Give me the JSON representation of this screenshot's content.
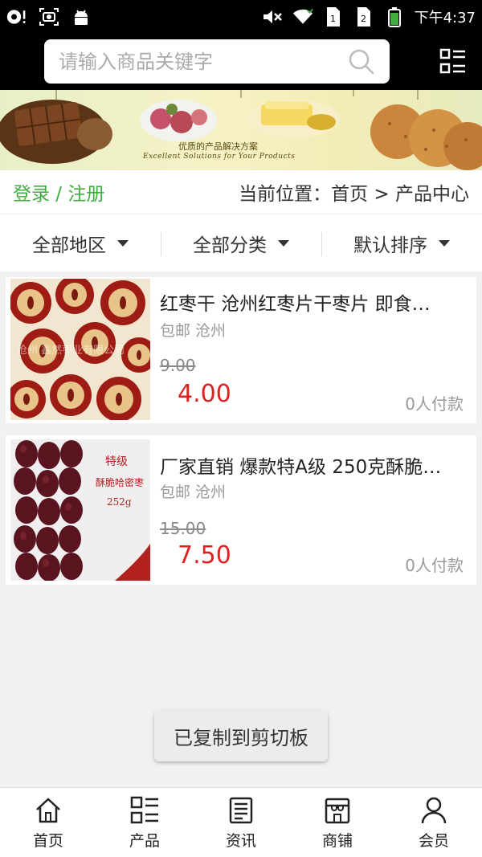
{
  "status_bar": {
    "time": "下午4:37",
    "icons": [
      "whirl-icon",
      "screenshot-icon",
      "android-icon",
      "mute-icon",
      "wifi-icon",
      "sim1-icon",
      "sim2-icon",
      "battery-icon"
    ]
  },
  "search": {
    "placeholder": "请输入商品关键字",
    "value": "",
    "icon": "search-icon"
  },
  "header": {
    "menu_icon": "grid-list-icon"
  },
  "banner": {
    "caption": "优质的产品解决方案",
    "subcaption": "Excellent Solutions for Your Products"
  },
  "locbar": {
    "login_label": "登录 / 注册",
    "location_label": "当前位置：首页 > 产品中心"
  },
  "filters": [
    {
      "label": "全部地区"
    },
    {
      "label": "全部分类"
    },
    {
      "label": "默认排序"
    }
  ],
  "products": [
    {
      "title": "红枣干 沧州红枣片干枣片 即食…",
      "tags": "包邮 沧州",
      "old_price": "9.00",
      "price": "4.00",
      "sales": "0人付款",
      "watermark": "沧州 鑫然枣业有限公司"
    },
    {
      "title": "厂家直销 爆款特A级 250克酥脆…",
      "tags": "包邮 沧州",
      "old_price": "15.00",
      "price": "7.50",
      "sales": "0人付款",
      "label_line1": "特级",
      "label_line2": "酥脆哈密枣",
      "label_line3": "252g"
    }
  ],
  "toast": "已复制到剪切板",
  "bottom_nav": [
    {
      "label": "首页",
      "icon": "home-icon"
    },
    {
      "label": "产品",
      "icon": "product-grid-icon"
    },
    {
      "label": "资讯",
      "icon": "news-icon"
    },
    {
      "label": "商铺",
      "icon": "store-icon"
    },
    {
      "label": "会员",
      "icon": "user-icon"
    }
  ],
  "colors": {
    "accent_green": "#3fae3f",
    "price_red": "#e02020",
    "header_bg": "#000000"
  }
}
